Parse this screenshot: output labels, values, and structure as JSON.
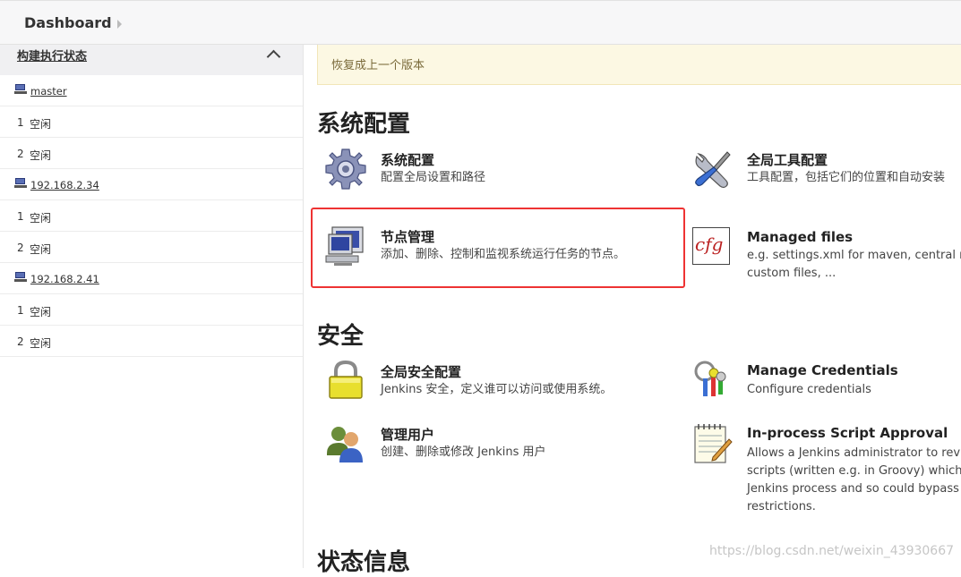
{
  "breadcrumb": {
    "root": "Dashboard"
  },
  "sidebar": {
    "header": "构建执行状态",
    "rows": [
      {
        "type": "node",
        "label": "master"
      },
      {
        "type": "executor",
        "num": "1",
        "state": "空闲"
      },
      {
        "type": "executor",
        "num": "2",
        "state": "空闲"
      },
      {
        "type": "node",
        "label": "192.168.2.34"
      },
      {
        "type": "executor",
        "num": "1",
        "state": "空闲"
      },
      {
        "type": "executor",
        "num": "2",
        "state": "空闲"
      },
      {
        "type": "node",
        "label": "192.168.2.41"
      },
      {
        "type": "executor",
        "num": "1",
        "state": "空闲"
      },
      {
        "type": "executor",
        "num": "2",
        "state": "空闲"
      }
    ]
  },
  "notice": {
    "text": "恢复成上一个版本"
  },
  "sections": {
    "system": {
      "title": "系统配置",
      "items": {
        "config": {
          "title": "系统配置",
          "desc": "配置全局设置和路径",
          "icon": "gear-icon"
        },
        "tools": {
          "title": "全局工具配置",
          "desc": "工具配置，包括它们的位置和自动安装",
          "icon": "tools-icon"
        },
        "nodes": {
          "title": "节点管理",
          "desc": "添加、删除、控制和监视系统运行任务的节点。",
          "icon": "computer-icon"
        },
        "files": {
          "title": "Managed files",
          "desc1": "e.g. settings.xml for maven, central man",
          "desc2": "custom files, ...",
          "icon": "cfg-icon",
          "icon_text": "cfg"
        }
      }
    },
    "security": {
      "title": "安全",
      "items": {
        "global": {
          "title": "全局安全配置",
          "desc": "Jenkins 安全，定义谁可以访问或使用系统。",
          "icon": "lock-icon"
        },
        "creds": {
          "title": "Manage Credentials",
          "desc": "Configure credentials",
          "icon": "keys-icon"
        },
        "users": {
          "title": "管理用户",
          "desc": "创建、删除或修改 Jenkins 用户",
          "icon": "users-icon"
        },
        "script": {
          "title": "In-process Script Approval",
          "desc1": "Allows a Jenkins administrator to review",
          "desc2": "scripts (written e.g. in Groovy) which ru",
          "desc3": "Jenkins process and so could bypass se",
          "desc4": "restrictions.",
          "icon": "notepad-icon"
        }
      }
    },
    "status": {
      "title": "状态信息"
    }
  },
  "watermark": "https://blog.csdn.net/weixin_43930667",
  "colors": {
    "highlight": "#ee3333",
    "notice_bg": "#fcf8e3",
    "sidebar_header_bg": "#f0f0f2"
  }
}
